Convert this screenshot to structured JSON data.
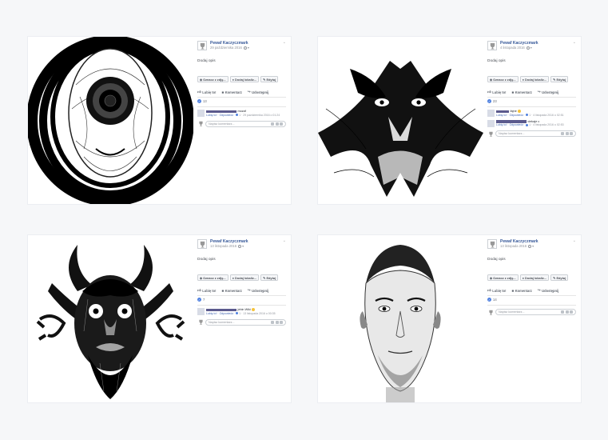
{
  "posts": [
    {
      "author": "Pewaf Kaczyczmark",
      "date": "29 października 2016",
      "description": "Dodaj opis",
      "tag_buttons": [
        "Oznacz z zdję...",
        "Dodaj lokaliz...",
        "Edytuj"
      ],
      "actions": [
        "Lubię to!",
        "Komentarz",
        "Udostępnij"
      ],
      "like_count": "13",
      "comments": [
        {
          "text": "mozaf",
          "meta_like": "Lubię to!",
          "meta_reply": "Odpowiedz",
          "meta_count": "1",
          "meta_time": "29 października 2016 o 01:24"
        }
      ],
      "write_placeholder": "Napisz komentarz..."
    },
    {
      "author": "Pewaf Kaczyczmark",
      "date": "4 listopada 2016",
      "description": "Dodaj opis",
      "tag_buttons": [
        "Oznacz z zdję...",
        "Dodaj lokaliz...",
        "Edytuj"
      ],
      "actions": [
        "Lubię to!",
        "Komentarz",
        "Udostępnij"
      ],
      "like_count": "23",
      "comments": [
        {
          "text": "fajne",
          "meta_like": "Lubię to!",
          "meta_reply": "Odpowiedz",
          "meta_count": "1",
          "meta_time": "4 listopada 2016 o 02:51"
        },
        {
          "text": "ciekaje c",
          "meta_like": "Lubię to!",
          "meta_reply": "Odpowiedz",
          "meta_count": "1",
          "meta_time": "4 listopada 2016 o 02:53"
        }
      ],
      "write_placeholder": "Napisz komentarz..."
    },
    {
      "author": "Pewaf Kaczyczmark",
      "date": "13 listopada 2016",
      "description": "Dodaj opis",
      "tag_buttons": [
        "Oznacz z zdję...",
        "Dodaj lokaliz...",
        "Edytuj"
      ],
      "actions": [
        "Lubię to!",
        "Komentarz",
        "Udostępnij"
      ],
      "like_count": "7",
      "comments": [
        {
          "text": "jebin Wiki",
          "meta_like": "Lubię to!",
          "meta_reply": "Odpowiedz",
          "meta_count": "1",
          "meta_time": "13 listopada 2016 o 00:35"
        }
      ],
      "write_placeholder": "Napisz komentarz..."
    },
    {
      "author": "Pewaf Kaczyczmark",
      "date": "13 listopada 2016",
      "description": "Dodaj opis",
      "tag_buttons": [
        "Oznacz z zdję...",
        "Dodaj lokaliz...",
        "Edytuj"
      ],
      "actions": [
        "Lubię to!",
        "Komentarz",
        "Udostępnij"
      ],
      "like_count": "14",
      "comments": [],
      "write_placeholder": "Napisz komentarz..."
    }
  ]
}
